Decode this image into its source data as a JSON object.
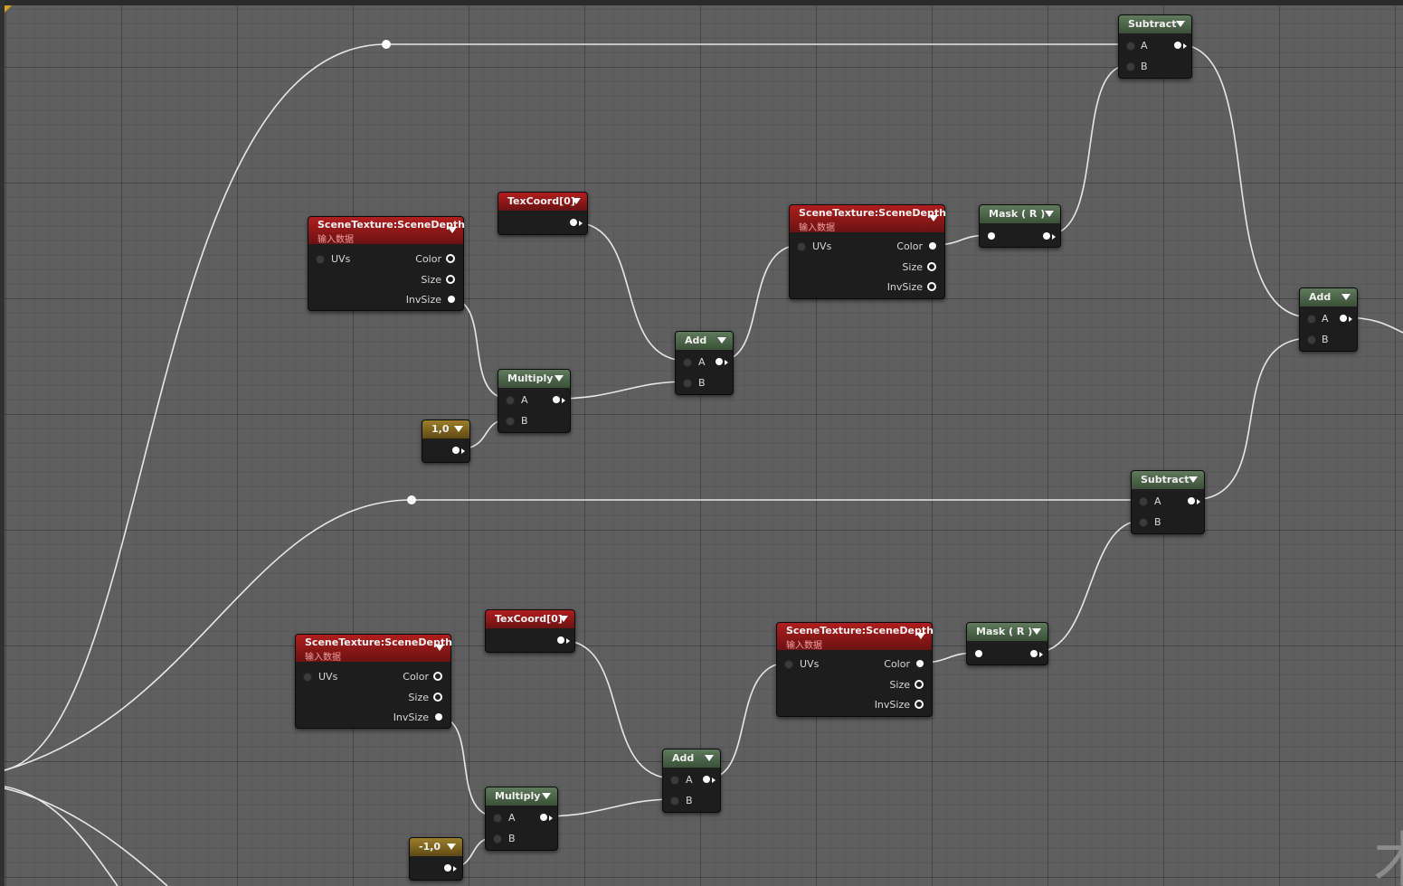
{
  "graph": {
    "nodes": {
      "scene_depth_top_left": {
        "title": "SceneTexture:SceneDepth",
        "subtitle": "输入数据",
        "in_label": "UVs",
        "out_labels": [
          "Color",
          "Size",
          "InvSize"
        ]
      },
      "texcoord_top": {
        "title": "TexCoord[0]"
      },
      "scene_depth_top_right": {
        "title": "SceneTexture:SceneDepth",
        "subtitle": "输入数据",
        "in_label": "UVs",
        "out_labels": [
          "Color",
          "Size",
          "InvSize"
        ]
      },
      "mask_top": {
        "title": "Mask ( R )"
      },
      "subtract_top": {
        "title": "Subtract",
        "in_a": "A",
        "in_b": "B"
      },
      "add_top": {
        "title": "Add",
        "in_a": "A",
        "in_b": "B"
      },
      "multiply_top": {
        "title": "Multiply",
        "in_a": "A",
        "in_b": "B"
      },
      "const_top": {
        "title": "1,0"
      },
      "add_final": {
        "title": "Add",
        "in_a": "A",
        "in_b": "B"
      },
      "subtract_bottom": {
        "title": "Subtract",
        "in_a": "A",
        "in_b": "B"
      },
      "scene_depth_bottom_left": {
        "title": "SceneTexture:SceneDepth",
        "subtitle": "输入数据",
        "in_label": "UVs",
        "out_labels": [
          "Color",
          "Size",
          "InvSize"
        ]
      },
      "texcoord_bottom": {
        "title": "TexCoord[0]"
      },
      "scene_depth_bottom_right": {
        "title": "SceneTexture:SceneDepth",
        "subtitle": "输入数据",
        "in_label": "UVs",
        "out_labels": [
          "Color",
          "Size",
          "InvSize"
        ]
      },
      "mask_bottom": {
        "title": "Mask ( R )"
      },
      "add_bottom": {
        "title": "Add",
        "in_a": "A",
        "in_b": "B"
      },
      "multiply_bottom": {
        "title": "Multiply",
        "in_a": "A",
        "in_b": "B"
      },
      "const_bottom": {
        "title": "-1,0"
      }
    },
    "watermark": "术",
    "colors": {
      "texture_header": "#9e1c1c",
      "math_header": "#536c50",
      "constant_header": "#8a6e22",
      "wire": "#e8e8e8",
      "canvas": "#5f5f5f"
    }
  }
}
